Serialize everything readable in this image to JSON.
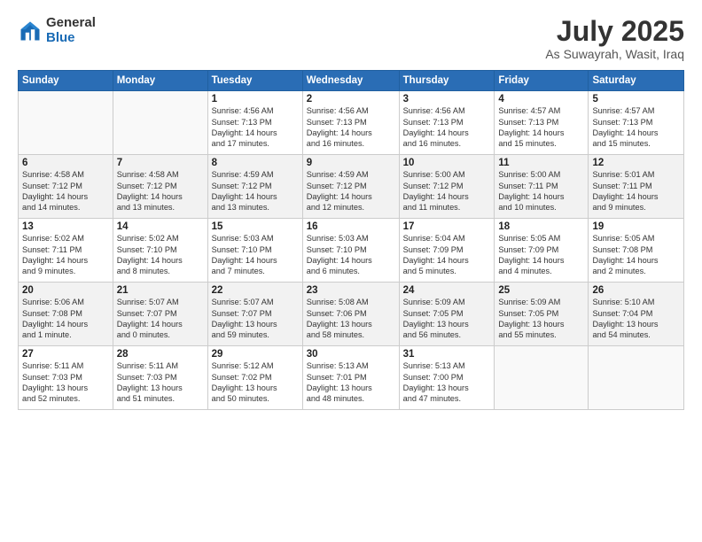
{
  "header": {
    "logo_general": "General",
    "logo_blue": "Blue",
    "month_title": "July 2025",
    "location": "As Suwayrah, Wasit, Iraq"
  },
  "days_of_week": [
    "Sunday",
    "Monday",
    "Tuesday",
    "Wednesday",
    "Thursday",
    "Friday",
    "Saturday"
  ],
  "weeks": [
    [
      {
        "day": "",
        "info": ""
      },
      {
        "day": "",
        "info": ""
      },
      {
        "day": "1",
        "info": "Sunrise: 4:56 AM\nSunset: 7:13 PM\nDaylight: 14 hours\nand 17 minutes."
      },
      {
        "day": "2",
        "info": "Sunrise: 4:56 AM\nSunset: 7:13 PM\nDaylight: 14 hours\nand 16 minutes."
      },
      {
        "day": "3",
        "info": "Sunrise: 4:56 AM\nSunset: 7:13 PM\nDaylight: 14 hours\nand 16 minutes."
      },
      {
        "day": "4",
        "info": "Sunrise: 4:57 AM\nSunset: 7:13 PM\nDaylight: 14 hours\nand 15 minutes."
      },
      {
        "day": "5",
        "info": "Sunrise: 4:57 AM\nSunset: 7:13 PM\nDaylight: 14 hours\nand 15 minutes."
      }
    ],
    [
      {
        "day": "6",
        "info": "Sunrise: 4:58 AM\nSunset: 7:12 PM\nDaylight: 14 hours\nand 14 minutes."
      },
      {
        "day": "7",
        "info": "Sunrise: 4:58 AM\nSunset: 7:12 PM\nDaylight: 14 hours\nand 13 minutes."
      },
      {
        "day": "8",
        "info": "Sunrise: 4:59 AM\nSunset: 7:12 PM\nDaylight: 14 hours\nand 13 minutes."
      },
      {
        "day": "9",
        "info": "Sunrise: 4:59 AM\nSunset: 7:12 PM\nDaylight: 14 hours\nand 12 minutes."
      },
      {
        "day": "10",
        "info": "Sunrise: 5:00 AM\nSunset: 7:12 PM\nDaylight: 14 hours\nand 11 minutes."
      },
      {
        "day": "11",
        "info": "Sunrise: 5:00 AM\nSunset: 7:11 PM\nDaylight: 14 hours\nand 10 minutes."
      },
      {
        "day": "12",
        "info": "Sunrise: 5:01 AM\nSunset: 7:11 PM\nDaylight: 14 hours\nand 9 minutes."
      }
    ],
    [
      {
        "day": "13",
        "info": "Sunrise: 5:02 AM\nSunset: 7:11 PM\nDaylight: 14 hours\nand 9 minutes."
      },
      {
        "day": "14",
        "info": "Sunrise: 5:02 AM\nSunset: 7:10 PM\nDaylight: 14 hours\nand 8 minutes."
      },
      {
        "day": "15",
        "info": "Sunrise: 5:03 AM\nSunset: 7:10 PM\nDaylight: 14 hours\nand 7 minutes."
      },
      {
        "day": "16",
        "info": "Sunrise: 5:03 AM\nSunset: 7:10 PM\nDaylight: 14 hours\nand 6 minutes."
      },
      {
        "day": "17",
        "info": "Sunrise: 5:04 AM\nSunset: 7:09 PM\nDaylight: 14 hours\nand 5 minutes."
      },
      {
        "day": "18",
        "info": "Sunrise: 5:05 AM\nSunset: 7:09 PM\nDaylight: 14 hours\nand 4 minutes."
      },
      {
        "day": "19",
        "info": "Sunrise: 5:05 AM\nSunset: 7:08 PM\nDaylight: 14 hours\nand 2 minutes."
      }
    ],
    [
      {
        "day": "20",
        "info": "Sunrise: 5:06 AM\nSunset: 7:08 PM\nDaylight: 14 hours\nand 1 minute."
      },
      {
        "day": "21",
        "info": "Sunrise: 5:07 AM\nSunset: 7:07 PM\nDaylight: 14 hours\nand 0 minutes."
      },
      {
        "day": "22",
        "info": "Sunrise: 5:07 AM\nSunset: 7:07 PM\nDaylight: 13 hours\nand 59 minutes."
      },
      {
        "day": "23",
        "info": "Sunrise: 5:08 AM\nSunset: 7:06 PM\nDaylight: 13 hours\nand 58 minutes."
      },
      {
        "day": "24",
        "info": "Sunrise: 5:09 AM\nSunset: 7:05 PM\nDaylight: 13 hours\nand 56 minutes."
      },
      {
        "day": "25",
        "info": "Sunrise: 5:09 AM\nSunset: 7:05 PM\nDaylight: 13 hours\nand 55 minutes."
      },
      {
        "day": "26",
        "info": "Sunrise: 5:10 AM\nSunset: 7:04 PM\nDaylight: 13 hours\nand 54 minutes."
      }
    ],
    [
      {
        "day": "27",
        "info": "Sunrise: 5:11 AM\nSunset: 7:03 PM\nDaylight: 13 hours\nand 52 minutes."
      },
      {
        "day": "28",
        "info": "Sunrise: 5:11 AM\nSunset: 7:03 PM\nDaylight: 13 hours\nand 51 minutes."
      },
      {
        "day": "29",
        "info": "Sunrise: 5:12 AM\nSunset: 7:02 PM\nDaylight: 13 hours\nand 50 minutes."
      },
      {
        "day": "30",
        "info": "Sunrise: 5:13 AM\nSunset: 7:01 PM\nDaylight: 13 hours\nand 48 minutes."
      },
      {
        "day": "31",
        "info": "Sunrise: 5:13 AM\nSunset: 7:00 PM\nDaylight: 13 hours\nand 47 minutes."
      },
      {
        "day": "",
        "info": ""
      },
      {
        "day": "",
        "info": ""
      }
    ]
  ]
}
